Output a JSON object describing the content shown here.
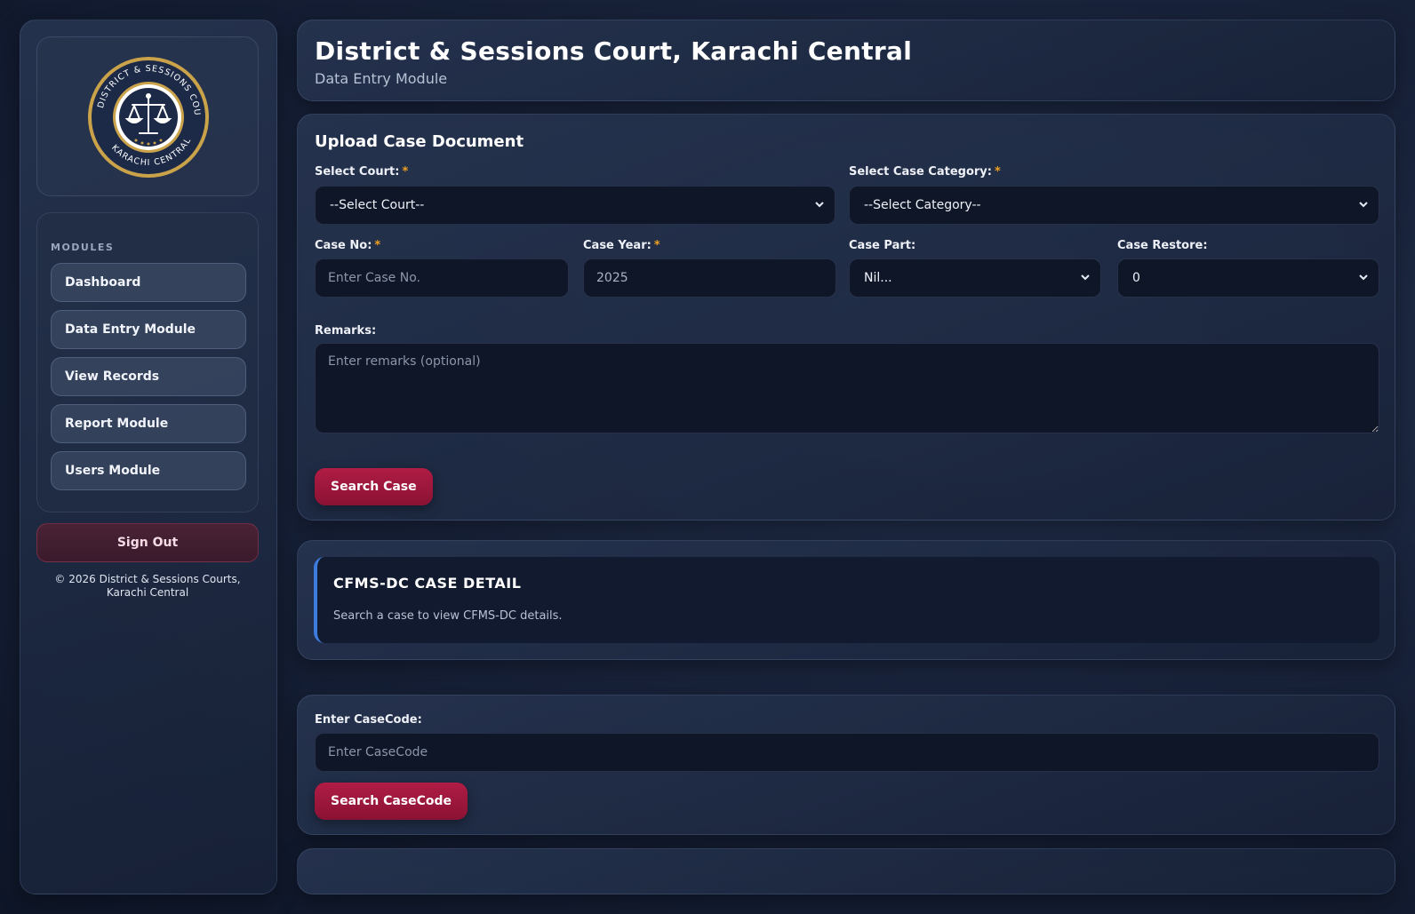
{
  "sidebar": {
    "logo": {
      "ring_text_top": "DISTRICT & SESSIONS COURTS",
      "ring_text_bottom": "KARACHI CENTRAL",
      "colors": {
        "gold": "#c9a24a",
        "navy": "#1c2a48"
      }
    },
    "modules_heading": "MODULES",
    "items": [
      {
        "label": "Dashboard"
      },
      {
        "label": "Data Entry Module"
      },
      {
        "label": "View Records"
      },
      {
        "label": "Report Module"
      },
      {
        "label": "Users Module"
      }
    ],
    "sign_out": "Sign Out",
    "copyright": "© 2026 District & Sessions Courts, Karachi Central"
  },
  "header": {
    "title": "District & Sessions Court, Karachi Central",
    "subtitle": "Data Entry Module"
  },
  "upload": {
    "title": "Upload Case Document",
    "court": {
      "label": "Select Court:",
      "value": "--Select Court--"
    },
    "category": {
      "label": "Select Case Category:",
      "value": "--Select Category--"
    },
    "case_no": {
      "label": "Case No:",
      "placeholder": "Enter Case No."
    },
    "case_year": {
      "label": "Case Year:",
      "value": "2025"
    },
    "case_part": {
      "label": "Case Part:",
      "value": "Nil..."
    },
    "case_restore": {
      "label": "Case Restore:",
      "value": "0"
    },
    "remarks": {
      "label": "Remarks:",
      "placeholder": "Enter remarks (optional)"
    },
    "required_mark": "*",
    "search_button": "Search Case"
  },
  "cfms": {
    "title": "CFMS-DC CASE DETAIL",
    "message": "Search a case to view CFMS-DC details."
  },
  "casecode": {
    "label": "Enter CaseCode:",
    "placeholder": "Enter CaseCode",
    "button": "Search CaseCode"
  },
  "colors": {
    "accent_red": "#b01c44",
    "accent_blue": "#3d7bdc",
    "required_orange": "#f0a020"
  }
}
